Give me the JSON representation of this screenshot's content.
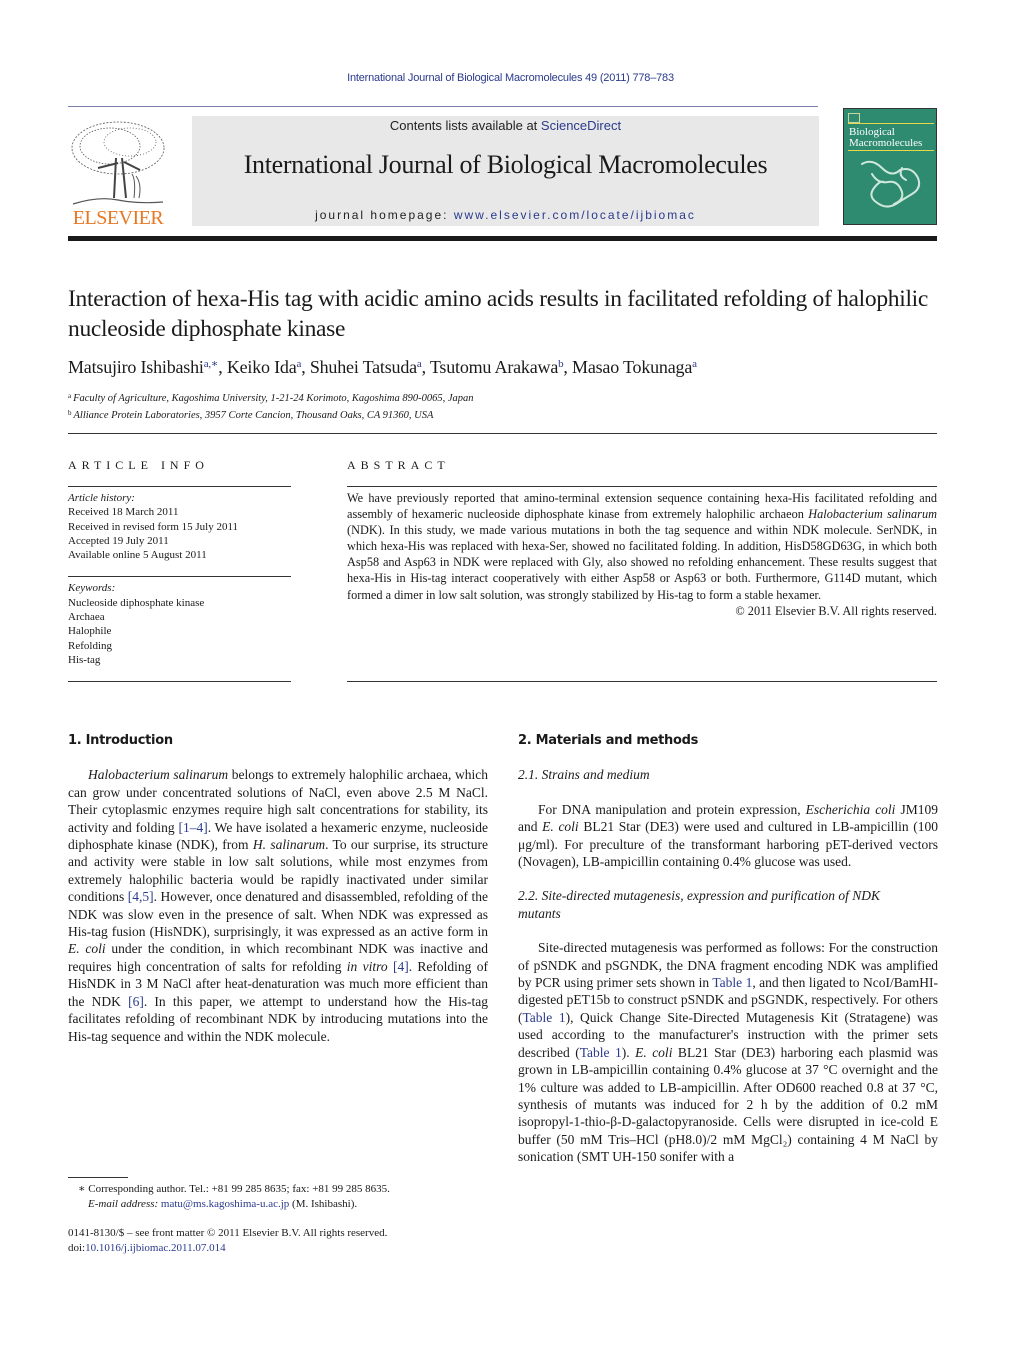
{
  "running_head": "International Journal of Biological Macromolecules 49 (2011) 778–783",
  "publisher": {
    "logo_text": "ELSEVIER",
    "logo_color": "#e87722"
  },
  "masthead": {
    "contents_prefix": "Contents lists available at ",
    "contents_link": "ScienceDirect",
    "journal_name": "International Journal of Biological Macromolecules",
    "homepage_prefix": "journal homepage: ",
    "homepage_link": "www.elsevier.com/locate/ijbiomac"
  },
  "cover": {
    "title_line1": "Biological",
    "title_line2": "Macromolecules",
    "color": "#2e8b6f"
  },
  "article": {
    "title": "Interaction of hexa-His tag with acidic amino acids results in facilitated refolding of halophilic nucleoside diphosphate kinase",
    "authors": [
      {
        "name": "Matsujiro Ishibashi",
        "sup": "a,∗"
      },
      {
        "name": "Keiko Ida",
        "sup": "a"
      },
      {
        "name": "Shuhei Tatsuda",
        "sup": "a"
      },
      {
        "name": "Tsutomu Arakawa",
        "sup": "b"
      },
      {
        "name": "Masao Tokunaga",
        "sup": "a"
      }
    ],
    "affiliations": [
      {
        "mark": "a",
        "text": "Faculty of Agriculture, Kagoshima University, 1-21-24 Korimoto, Kagoshima 890-0065, Japan"
      },
      {
        "mark": "b",
        "text": "Alliance Protein Laboratories, 3957 Corte Cancion, Thousand Oaks, CA 91360, USA"
      }
    ]
  },
  "article_info": {
    "heading": "ARTICLE INFO",
    "history_label": "Article history:",
    "history": [
      "Received 18 March 2011",
      "Received in revised form 15 July 2011",
      "Accepted 19 July 2011",
      "Available online 5 August 2011"
    ],
    "keywords_label": "Keywords:",
    "keywords": [
      "Nucleoside diphosphate kinase",
      "Archaea",
      "Halophile",
      "Refolding",
      "His-tag"
    ]
  },
  "abstract": {
    "heading": "ABSTRACT",
    "text_1": "We have previously reported that amino-terminal extension sequence containing hexa-His facilitated refolding and assembly of hexameric nucleoside diphosphate kinase from extremely halophilic archaeon ",
    "text_italic": "Halobacterium salinarum",
    "text_2": " (NDK). In this study, we made various mutations in both the tag sequence and within NDK molecule. SerNDK, in which hexa-His was replaced with hexa-Ser, showed no facilitated folding. In addition, HisD58GD63G, in which both Asp58 and Asp63 in NDK were replaced with Gly, also showed no refolding enhancement. These results suggest that hexa-His in His-tag interact cooperatively with either Asp58 or Asp63 or both. Furthermore, G114D mutant, which formed a dimer in low salt solution, was strongly stabilized by His-tag to form a stable hexamer.",
    "copyright": "© 2011 Elsevier B.V. All rights reserved."
  },
  "intro": {
    "heading": "1.  Introduction",
    "s1_italic": "Halobacterium salinarum",
    "s1": " belongs to extremely halophilic archaea, which can grow under concentrated solutions of NaCl, even above 2.5 M NaCl. Their cytoplasmic enzymes require high salt concentrations for stability, its activity and folding ",
    "ref1": "[1–4]",
    "s2": ". We have isolated a hexameric enzyme, nucleoside diphosphate kinase (NDK), from ",
    "s2_italic": "H. salinarum",
    "s3": ". To our surprise, its structure and activity were stable in low salt solutions, while most enzymes from extremely halophilic bacteria would be rapidly inactivated under similar conditions ",
    "ref2": "[4,5]",
    "s4": ". However, once denatured and disassembled, refolding of the NDK was slow even in the presence of salt. When NDK was expressed as His-tag fusion (HisNDK), surprisingly, it was expressed as an active form in ",
    "s4_italic": "E. coli",
    "s5": " under the condition, in which recombinant NDK was inactive and requires high concentration of salts for refolding ",
    "s5_italic": "in vitro",
    "s5b": " ",
    "ref3": "[4]",
    "s6": ". Refolding of HisNDK in 3 M NaCl after heat-denaturation was much more efficient than the NDK ",
    "ref4": "[6]",
    "s7": ". In this paper, we attempt to understand how the His-tag facilitates refolding of recombinant NDK by introducing mutations into the His-tag sequence and within the NDK molecule."
  },
  "methods": {
    "heading": "2.  Materials and methods",
    "sub1": "2.1.  Strains and medium",
    "p1_a": "For DNA manipulation and protein expression, ",
    "p1_i1": "Escherichia coli",
    "p1_b": " JM109 and ",
    "p1_i2": "E. coli",
    "p1_c": " BL21 Star (DE3) were used and cultured in LB-ampicillin (100 μg/ml). For preculture of the transformant harboring pET-derived vectors (Novagen), LB-ampicillin containing 0.4% glucose was used.",
    "sub2": "2.2.  Site-directed mutagenesis, expression and purification of NDK mutants",
    "p2_a": "Site-directed mutagenesis was performed as follows: For the construction of pSNDK and pSGNDK, the DNA fragment encoding NDK was amplified by PCR using primer sets shown in ",
    "table_ref": "Table 1",
    "p2_b": ", and then ligated to NcoI/BamHI-digested pET15b to construct pSNDK and pSGNDK, respectively. For others (",
    "p2_c": "), Quick Change Site-Directed Mutagenesis Kit (Stratagene) was used according to the manufacturer's instruction with the primer sets described (",
    "p2_d": "). ",
    "p2_i": "E. coli",
    "p2_e": " BL21 Star (DE3) harboring each plasmid was grown in LB-ampicillin containing 0.4% glucose at 37 °C overnight and the 1% culture was added to LB-ampicillin. After OD600 reached 0.8 at 37 °C, synthesis of mutants was induced for 2 h by the addition of 0.2 mM isopropyl-1-thio-β-D-galactopyranoside. Cells were disrupted in ice-cold E buffer (50 mM Tris–HCl (pH8.0)/2 mM MgCl₂) containing 4 M NaCl by sonication (SMT UH-150 sonifer with a"
  },
  "footnote": {
    "mark": "∗",
    "text": " Corresponding author. Tel.: +81 99 285 8635; fax: +81 99 285 8635.",
    "email_label": "E-mail address:",
    "email": "matu@ms.kagoshima-u.ac.jp",
    "email_suffix": " (M. Ishibashi)."
  },
  "front_matter": {
    "line1": "0141-8130/$ – see front matter © 2011 Elsevier B.V. All rights reserved.",
    "doi_prefix": "doi:",
    "doi": "10.1016/j.ijbiomac.2011.07.014"
  }
}
